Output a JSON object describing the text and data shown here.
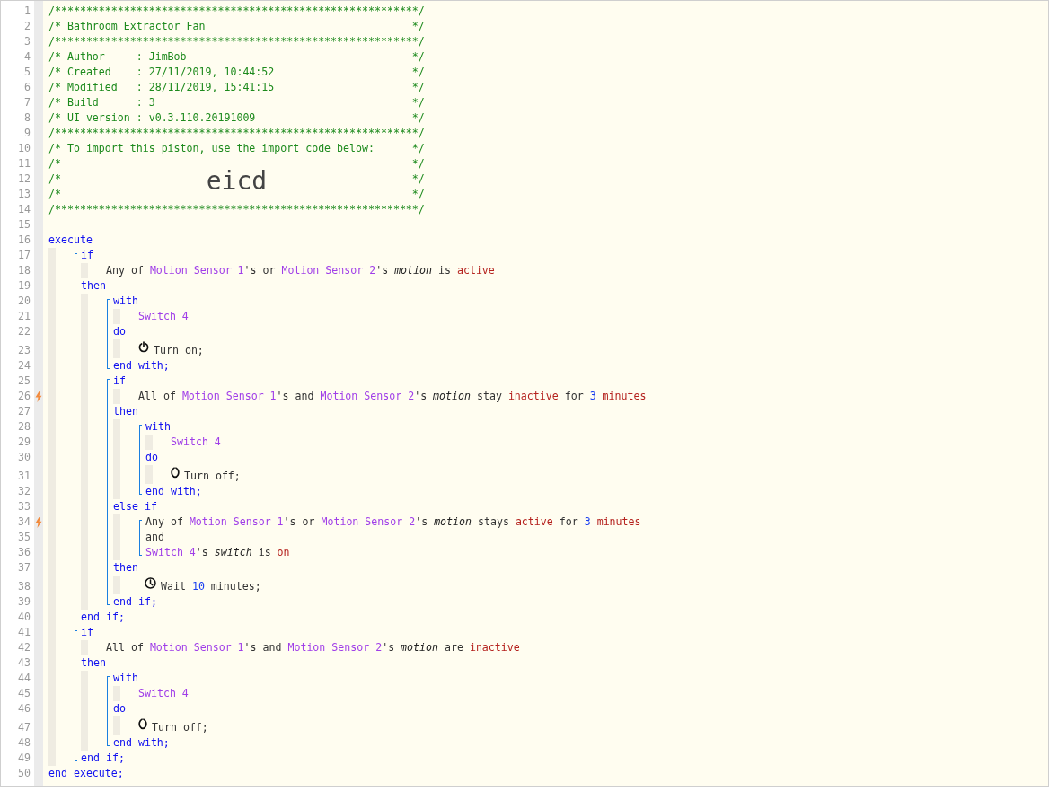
{
  "code": [
    {
      "no": "1",
      "kind": "banner",
      "trigger": false,
      "tokens": [
        {
          "text": "/**********************************************************/",
          "kind": "com"
        }
      ]
    },
    {
      "no": "2",
      "kind": "banner",
      "trigger": false,
      "tokens": [
        {
          "text": "/* Bathroom Extractor Fan",
          "kind": "com"
        },
        {
          "text": "*/",
          "kind": "com"
        }
      ]
    },
    {
      "no": "3",
      "kind": "banner",
      "trigger": false,
      "tokens": [
        {
          "text": "/**********************************************************/",
          "kind": "com"
        }
      ]
    },
    {
      "no": "4",
      "kind": "banner",
      "trigger": false,
      "tokens": [
        {
          "text": "/* Author     : JimBob",
          "kind": "com"
        },
        {
          "text": "*/",
          "kind": "com"
        }
      ]
    },
    {
      "no": "5",
      "kind": "banner",
      "trigger": false,
      "tokens": [
        {
          "text": "/* Created    : 27/11/2019, 10:44:52",
          "kind": "com"
        },
        {
          "text": "*/",
          "kind": "com"
        }
      ]
    },
    {
      "no": "6",
      "kind": "banner",
      "trigger": false,
      "tokens": [
        {
          "text": "/* Modified   : 28/11/2019, 15:41:15",
          "kind": "com"
        },
        {
          "text": "*/",
          "kind": "com"
        }
      ]
    },
    {
      "no": "7",
      "kind": "banner",
      "trigger": false,
      "tokens": [
        {
          "text": "/* Build      : 3",
          "kind": "com"
        },
        {
          "text": "*/",
          "kind": "com"
        }
      ]
    },
    {
      "no": "8",
      "kind": "banner",
      "trigger": false,
      "tokens": [
        {
          "text": "/* UI version : v0.3.110.20191009",
          "kind": "com"
        },
        {
          "text": "*/",
          "kind": "com"
        }
      ]
    },
    {
      "no": "9",
      "kind": "banner",
      "trigger": false,
      "tokens": [
        {
          "text": "/**********************************************************/",
          "kind": "com"
        }
      ]
    },
    {
      "no": "10",
      "kind": "banner",
      "trigger": false,
      "tokens": [
        {
          "text": "/* To import this piston, use the import code below:",
          "kind": "com"
        },
        {
          "text": "*/",
          "kind": "com"
        }
      ]
    },
    {
      "no": "11",
      "kind": "banner",
      "trigger": false,
      "tokens": [
        {
          "text": "/*",
          "kind": "com"
        },
        {
          "text": "*/",
          "kind": "com"
        }
      ]
    },
    {
      "no": "12",
      "kind": "banner",
      "trigger": false,
      "tokens": [
        {
          "text": "/*",
          "kind": "com"
        },
        {
          "text": "eicd",
          "kind": "big"
        },
        {
          "text": "*/",
          "kind": "com"
        }
      ]
    },
    {
      "no": "13",
      "kind": "banner",
      "trigger": false,
      "tokens": [
        {
          "text": "/*",
          "kind": "com"
        },
        {
          "text": "*/",
          "kind": "com"
        }
      ]
    },
    {
      "no": "14",
      "kind": "banner",
      "trigger": false,
      "tokens": [
        {
          "text": "/**********************************************************/",
          "kind": "com"
        }
      ]
    },
    {
      "no": "15",
      "kind": "code",
      "trigger": false
    },
    {
      "no": "16",
      "kind": "code",
      "trigger": false,
      "tokens": [
        {
          "text": "execute",
          "kind": "kw"
        }
      ],
      "children": [
        {
          "kind": "block",
          "lines": [
            {
              "no": "17",
              "kind": "code",
              "trigger": false,
              "tokens": [
                {
                  "text": "if",
                  "kind": "kw"
                }
              ],
              "children": [
                {
                  "no": "18",
                  "kind": "code",
                  "trigger": false,
                  "tokens": [
                    {
                      "text": "Any of ",
                      "kind": "txt"
                    },
                    {
                      "text": "Motion Sensor 1",
                      "kind": "dev"
                    },
                    {
                      "text": "'s or ",
                      "kind": "txt"
                    },
                    {
                      "text": "Motion Sensor 2",
                      "kind": "dev"
                    },
                    {
                      "text": "'s ",
                      "kind": "txt"
                    },
                    {
                      "text": "motion",
                      "kind": "attr"
                    },
                    {
                      "text": " is ",
                      "kind": "txt"
                    },
                    {
                      "text": "active",
                      "kind": "val"
                    }
                  ]
                }
              ]
            },
            {
              "no": "19",
              "kind": "code",
              "trigger": false,
              "tokens": [
                {
                  "text": "then",
                  "kind": "kw"
                }
              ],
              "children": [
                {
                  "kind": "block",
                  "lines": [
                    {
                      "no": "20",
                      "kind": "code",
                      "trigger": false,
                      "tokens": [
                        {
                          "text": "with",
                          "kind": "kw"
                        }
                      ],
                      "children": [
                        {
                          "no": "21",
                          "kind": "code",
                          "trigger": false,
                          "tokens": [
                            {
                              "text": "Switch 4",
                              "kind": "dev"
                            }
                          ]
                        }
                      ]
                    },
                    {
                      "no": "22",
                      "kind": "code",
                      "trigger": false,
                      "tokens": [
                        {
                          "text": "do",
                          "kind": "kw"
                        }
                      ],
                      "children": [
                        {
                          "no": "23",
                          "kind": "power",
                          "trigger": false,
                          "tokens": [
                            {
                              "text": "Turn on;",
                              "kind": "txt"
                            }
                          ]
                        }
                      ]
                    },
                    {
                      "no": "24",
                      "kind": "code",
                      "trigger": false,
                      "tokens": [
                        {
                          "text": "end with;",
                          "kind": "kw"
                        }
                      ]
                    }
                  ]
                },
                {
                  "kind": "block",
                  "lines": [
                    {
                      "no": "25",
                      "kind": "code",
                      "trigger": false,
                      "tokens": [
                        {
                          "text": "if",
                          "kind": "kw"
                        }
                      ],
                      "children": [
                        {
                          "no": "26",
                          "kind": "code",
                          "trigger": true,
                          "tokens": [
                            {
                              "text": "All of ",
                              "kind": "txt"
                            },
                            {
                              "text": "Motion Sensor 1",
                              "kind": "dev"
                            },
                            {
                              "text": "'s and ",
                              "kind": "txt"
                            },
                            {
                              "text": "Motion Sensor 2",
                              "kind": "dev"
                            },
                            {
                              "text": "'s ",
                              "kind": "txt"
                            },
                            {
                              "text": "motion",
                              "kind": "attr"
                            },
                            {
                              "text": " stay ",
                              "kind": "txt"
                            },
                            {
                              "text": "inactive",
                              "kind": "val"
                            },
                            {
                              "text": " for ",
                              "kind": "txt"
                            },
                            {
                              "text": "3",
                              "kind": "num"
                            },
                            {
                              "text": " minutes",
                              "kind": "val"
                            }
                          ]
                        }
                      ]
                    },
                    {
                      "no": "27",
                      "kind": "code",
                      "trigger": false,
                      "tokens": [
                        {
                          "text": "then",
                          "kind": "kw"
                        }
                      ],
                      "children": [
                        {
                          "kind": "block",
                          "lines": [
                            {
                              "no": "28",
                              "kind": "code",
                              "trigger": false,
                              "tokens": [
                                {
                                  "text": "with",
                                  "kind": "kw"
                                }
                              ],
                              "children": [
                                {
                                  "no": "29",
                                  "kind": "code",
                                  "trigger": false,
                                  "tokens": [
                                    {
                                      "text": "Switch 4",
                                      "kind": "dev"
                                    }
                                  ]
                                }
                              ]
                            },
                            {
                              "no": "30",
                              "kind": "code",
                              "trigger": false,
                              "tokens": [
                                {
                                  "text": "do",
                                  "kind": "kw"
                                }
                              ],
                              "children": [
                                {
                                  "no": "31",
                                  "kind": "off",
                                  "trigger": false,
                                  "tokens": [
                                    {
                                      "text": "Turn off;",
                                      "kind": "txt"
                                    }
                                  ]
                                }
                              ]
                            },
                            {
                              "no": "32",
                              "kind": "code",
                              "trigger": false,
                              "tokens": [
                                {
                                  "text": "end with;",
                                  "kind": "kw"
                                }
                              ]
                            }
                          ]
                        }
                      ]
                    },
                    {
                      "no": "33",
                      "kind": "code",
                      "trigger": false,
                      "tokens": [
                        {
                          "text": "else if",
                          "kind": "kw"
                        }
                      ],
                      "children": [
                        {
                          "kind": "block",
                          "lines": [
                            {
                              "no": "34",
                              "kind": "code",
                              "trigger": true,
                              "tokens": [
                                {
                                  "text": "Any of ",
                                  "kind": "txt"
                                },
                                {
                                  "text": "Motion Sensor 1",
                                  "kind": "dev"
                                },
                                {
                                  "text": "'s or ",
                                  "kind": "txt"
                                },
                                {
                                  "text": "Motion Sensor 2",
                                  "kind": "dev"
                                },
                                {
                                  "text": "'s ",
                                  "kind": "txt"
                                },
                                {
                                  "text": "motion",
                                  "kind": "attr"
                                },
                                {
                                  "text": " stays ",
                                  "kind": "txt"
                                },
                                {
                                  "text": "active",
                                  "kind": "val"
                                },
                                {
                                  "text": " for ",
                                  "kind": "txt"
                                },
                                {
                                  "text": "3",
                                  "kind": "num"
                                },
                                {
                                  "text": " minutes",
                                  "kind": "val"
                                }
                              ]
                            },
                            {
                              "no": "35",
                              "kind": "code",
                              "trigger": false,
                              "tokens": [
                                {
                                  "text": "and",
                                  "kind": "txt"
                                }
                              ]
                            },
                            {
                              "no": "36",
                              "kind": "code",
                              "trigger": false,
                              "tokens": [
                                {
                                  "text": "Switch 4",
                                  "kind": "dev"
                                },
                                {
                                  "text": "'s ",
                                  "kind": "txt"
                                },
                                {
                                  "text": "switch",
                                  "kind": "attr"
                                },
                                {
                                  "text": " is ",
                                  "kind": "txt"
                                },
                                {
                                  "text": "on",
                                  "kind": "val"
                                }
                              ]
                            }
                          ]
                        }
                      ]
                    },
                    {
                      "no": "37",
                      "kind": "code",
                      "trigger": false,
                      "tokens": [
                        {
                          "text": "then",
                          "kind": "kw"
                        }
                      ],
                      "children": [
                        {
                          "no": "38",
                          "kind": "clock",
                          "trigger": false,
                          "tokens": [
                            {
                              "text": "Wait ",
                              "kind": "txt"
                            },
                            {
                              "text": "10",
                              "kind": "num"
                            },
                            {
                              "text": " minutes;",
                              "kind": "txt"
                            }
                          ]
                        }
                      ]
                    },
                    {
                      "no": "39",
                      "kind": "code",
                      "trigger": false,
                      "tokens": [
                        {
                          "text": "end if;",
                          "kind": "kw"
                        }
                      ]
                    }
                  ]
                }
              ]
            },
            {
              "no": "40",
              "kind": "code",
              "trigger": false,
              "tokens": [
                {
                  "text": "end if;",
                  "kind": "kw"
                }
              ]
            }
          ]
        },
        {
          "kind": "block",
          "lines": [
            {
              "no": "41",
              "kind": "code",
              "trigger": false,
              "tokens": [
                {
                  "text": "if",
                  "kind": "kw"
                }
              ],
              "children": [
                {
                  "no": "42",
                  "kind": "code",
                  "trigger": false,
                  "tokens": [
                    {
                      "text": "All of ",
                      "kind": "txt"
                    },
                    {
                      "text": "Motion Sensor 1",
                      "kind": "dev"
                    },
                    {
                      "text": "'s and ",
                      "kind": "txt"
                    },
                    {
                      "text": "Motion Sensor 2",
                      "kind": "dev"
                    },
                    {
                      "text": "'s ",
                      "kind": "txt"
                    },
                    {
                      "text": "motion",
                      "kind": "attr"
                    },
                    {
                      "text": " are ",
                      "kind": "txt"
                    },
                    {
                      "text": "inactive",
                      "kind": "val"
                    }
                  ]
                }
              ]
            },
            {
              "no": "43",
              "kind": "code",
              "trigger": false,
              "tokens": [
                {
                  "text": "then",
                  "kind": "kw"
                }
              ],
              "children": [
                {
                  "kind": "block",
                  "lines": [
                    {
                      "no": "44",
                      "kind": "code",
                      "trigger": false,
                      "tokens": [
                        {
                          "text": "with",
                          "kind": "kw"
                        }
                      ],
                      "children": [
                        {
                          "no": "45",
                          "kind": "code",
                          "trigger": false,
                          "tokens": [
                            {
                              "text": "Switch 4",
                              "kind": "dev"
                            }
                          ]
                        }
                      ]
                    },
                    {
                      "no": "46",
                      "kind": "code",
                      "trigger": false,
                      "tokens": [
                        {
                          "text": "do",
                          "kind": "kw"
                        }
                      ],
                      "children": [
                        {
                          "no": "47",
                          "kind": "off",
                          "trigger": false,
                          "tokens": [
                            {
                              "text": "Turn off;",
                              "kind": "txt"
                            }
                          ]
                        }
                      ]
                    },
                    {
                      "no": "48",
                      "kind": "code",
                      "trigger": false,
                      "tokens": [
                        {
                          "text": "end with;",
                          "kind": "kw"
                        }
                      ]
                    }
                  ]
                }
              ]
            },
            {
              "no": "49",
              "kind": "code",
              "trigger": false,
              "tokens": [
                {
                  "text": "end if;",
                  "kind": "kw"
                }
              ]
            }
          ]
        }
      ]
    },
    {
      "no": "50",
      "kind": "code",
      "trigger": false,
      "tokens": [
        {
          "text": "end execute;",
          "kind": "kw"
        }
      ]
    }
  ]
}
